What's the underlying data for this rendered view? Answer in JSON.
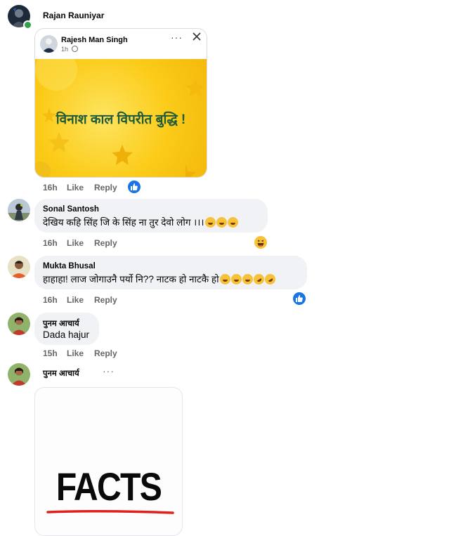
{
  "post": {
    "author": "Rajan Rauniyar",
    "shared": {
      "author": "Rajesh Man Singh",
      "time": "1h",
      "image_text": "विनाश काल विपरीत बुद्धि !"
    },
    "time": "16h",
    "like_label": "Like",
    "reply_label": "Reply"
  },
  "comments": [
    {
      "author": "Sonal Santosh",
      "text": "देखिय कहि सिंह जि के सिंह ना तुर देवो लोग ।।।",
      "emojis": [
        "laugh",
        "laugh",
        "laugh"
      ],
      "time": "16h",
      "like_label": "Like",
      "reply_label": "Reply",
      "reaction": "haha"
    },
    {
      "author": "Mukta Bhusal",
      "text": "हाहाहा! लाज जोगाउनै पर्यो नि?? नाटक हो नाटकै हो",
      "emojis": [
        "laugh",
        "laugh",
        "laugh",
        "rofl",
        "rofl"
      ],
      "time": "16h",
      "like_label": "Like",
      "reply_label": "Reply",
      "reaction": "like"
    },
    {
      "author": "पुनम आचार्य",
      "text": "Dada hajur",
      "time": "15h",
      "like_label": "Like",
      "reply_label": "Reply"
    },
    {
      "author": "पुनम आचार्य",
      "more_label": "···",
      "image_text": "FACTS"
    }
  ],
  "colors": {
    "like_blue": "#1b74e4",
    "bubble_bg": "#f0f2f5",
    "meta_gray": "#65676b",
    "image_yellow": "#fbcb18",
    "image_text_green": "#1f5a3a",
    "facts_red": "#e0201a"
  },
  "icons": [
    "like-icon",
    "haha-icon",
    "close-icon",
    "more-icon",
    "globe-icon",
    "online-dot-icon"
  ]
}
